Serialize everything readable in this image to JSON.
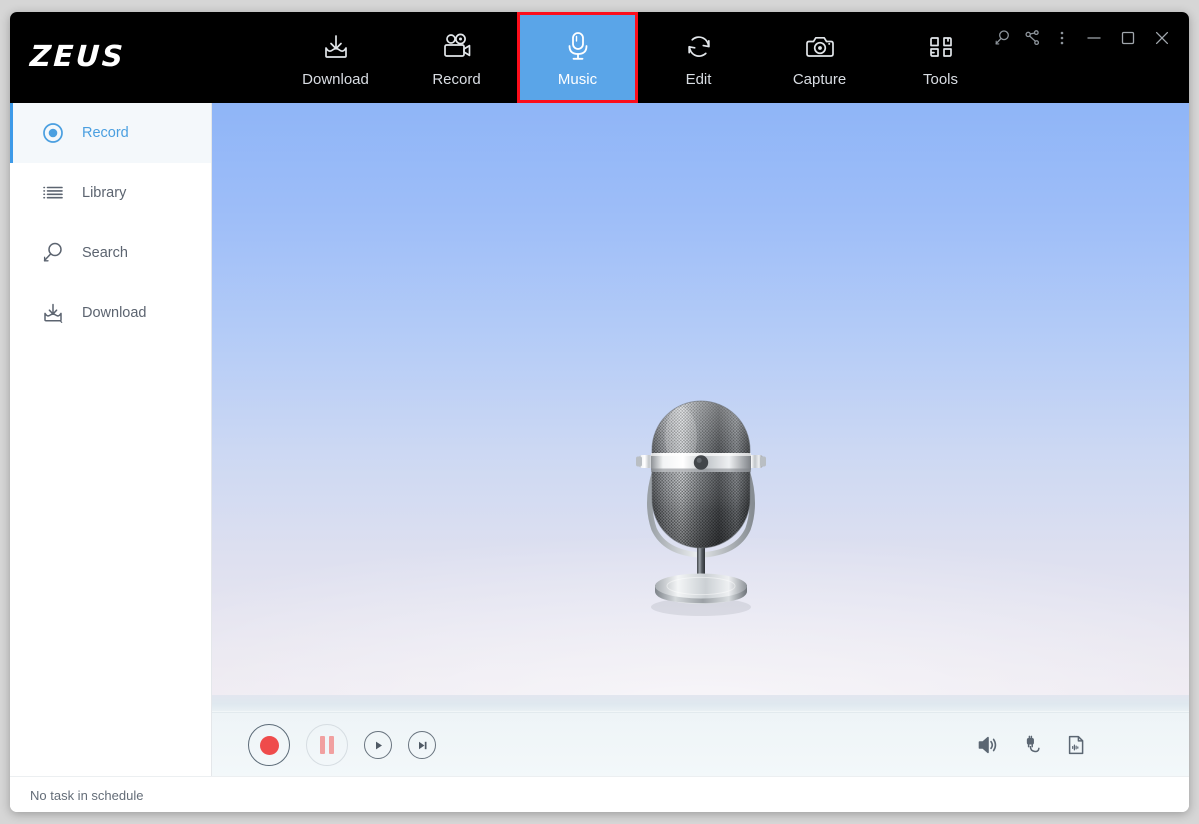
{
  "app": {
    "logo": "ZEUS"
  },
  "topnav": {
    "items": [
      {
        "label": "Download",
        "icon": "download-tray-icon",
        "active": false
      },
      {
        "label": "Record",
        "icon": "video-camera-icon",
        "active": false
      },
      {
        "label": "Music",
        "icon": "microphone-icon",
        "active": true
      },
      {
        "label": "Edit",
        "icon": "refresh-cycle-icon",
        "active": false
      },
      {
        "label": "Capture",
        "icon": "camera-icon",
        "active": false
      },
      {
        "label": "Tools",
        "icon": "grid-squares-icon",
        "active": false
      }
    ],
    "active_highlight_color": "#5aa5e8",
    "active_border_color": "#fc0d1b"
  },
  "window_controls": [
    {
      "name": "search-icon",
      "label": "Search"
    },
    {
      "name": "share-icon",
      "label": "Share"
    },
    {
      "name": "more-menu-icon",
      "label": "More"
    },
    {
      "name": "minimize-icon",
      "label": "Minimize"
    },
    {
      "name": "maximize-icon",
      "label": "Maximize"
    },
    {
      "name": "close-icon",
      "label": "Close"
    }
  ],
  "sidebar": {
    "items": [
      {
        "label": "Record",
        "icon": "record-circle-icon",
        "active": true
      },
      {
        "label": "Library",
        "icon": "list-icon",
        "active": false
      },
      {
        "label": "Search",
        "icon": "magnifier-icon",
        "active": false
      },
      {
        "label": "Download",
        "icon": "download-tray-icon",
        "active": false
      }
    ],
    "active_color": "#4a9fe0"
  },
  "stage": {
    "artwork": "retro-microphone-illustration",
    "sky_top_color": "#8fb5f7",
    "sky_bottom_color": "#eeeaf1"
  },
  "controls": {
    "record": {
      "label": "Record",
      "icon": "record-dot-icon",
      "enabled": true
    },
    "pause": {
      "label": "Pause",
      "icon": "pause-icon",
      "enabled": false
    },
    "play": {
      "label": "Play",
      "icon": "play-icon",
      "enabled": true
    },
    "next": {
      "label": "Next",
      "icon": "skip-next-icon",
      "enabled": true
    },
    "volume": {
      "label": "Volume",
      "icon": "speaker-icon"
    },
    "audio_source": {
      "label": "Audio Source",
      "icon": "audio-jack-icon"
    },
    "audio_file": {
      "label": "Audio File",
      "icon": "audio-file-icon"
    },
    "record_color": "#ef4b4b",
    "pause_color": "#f1a0a0"
  },
  "statusbar": {
    "text": "No task in schedule"
  }
}
